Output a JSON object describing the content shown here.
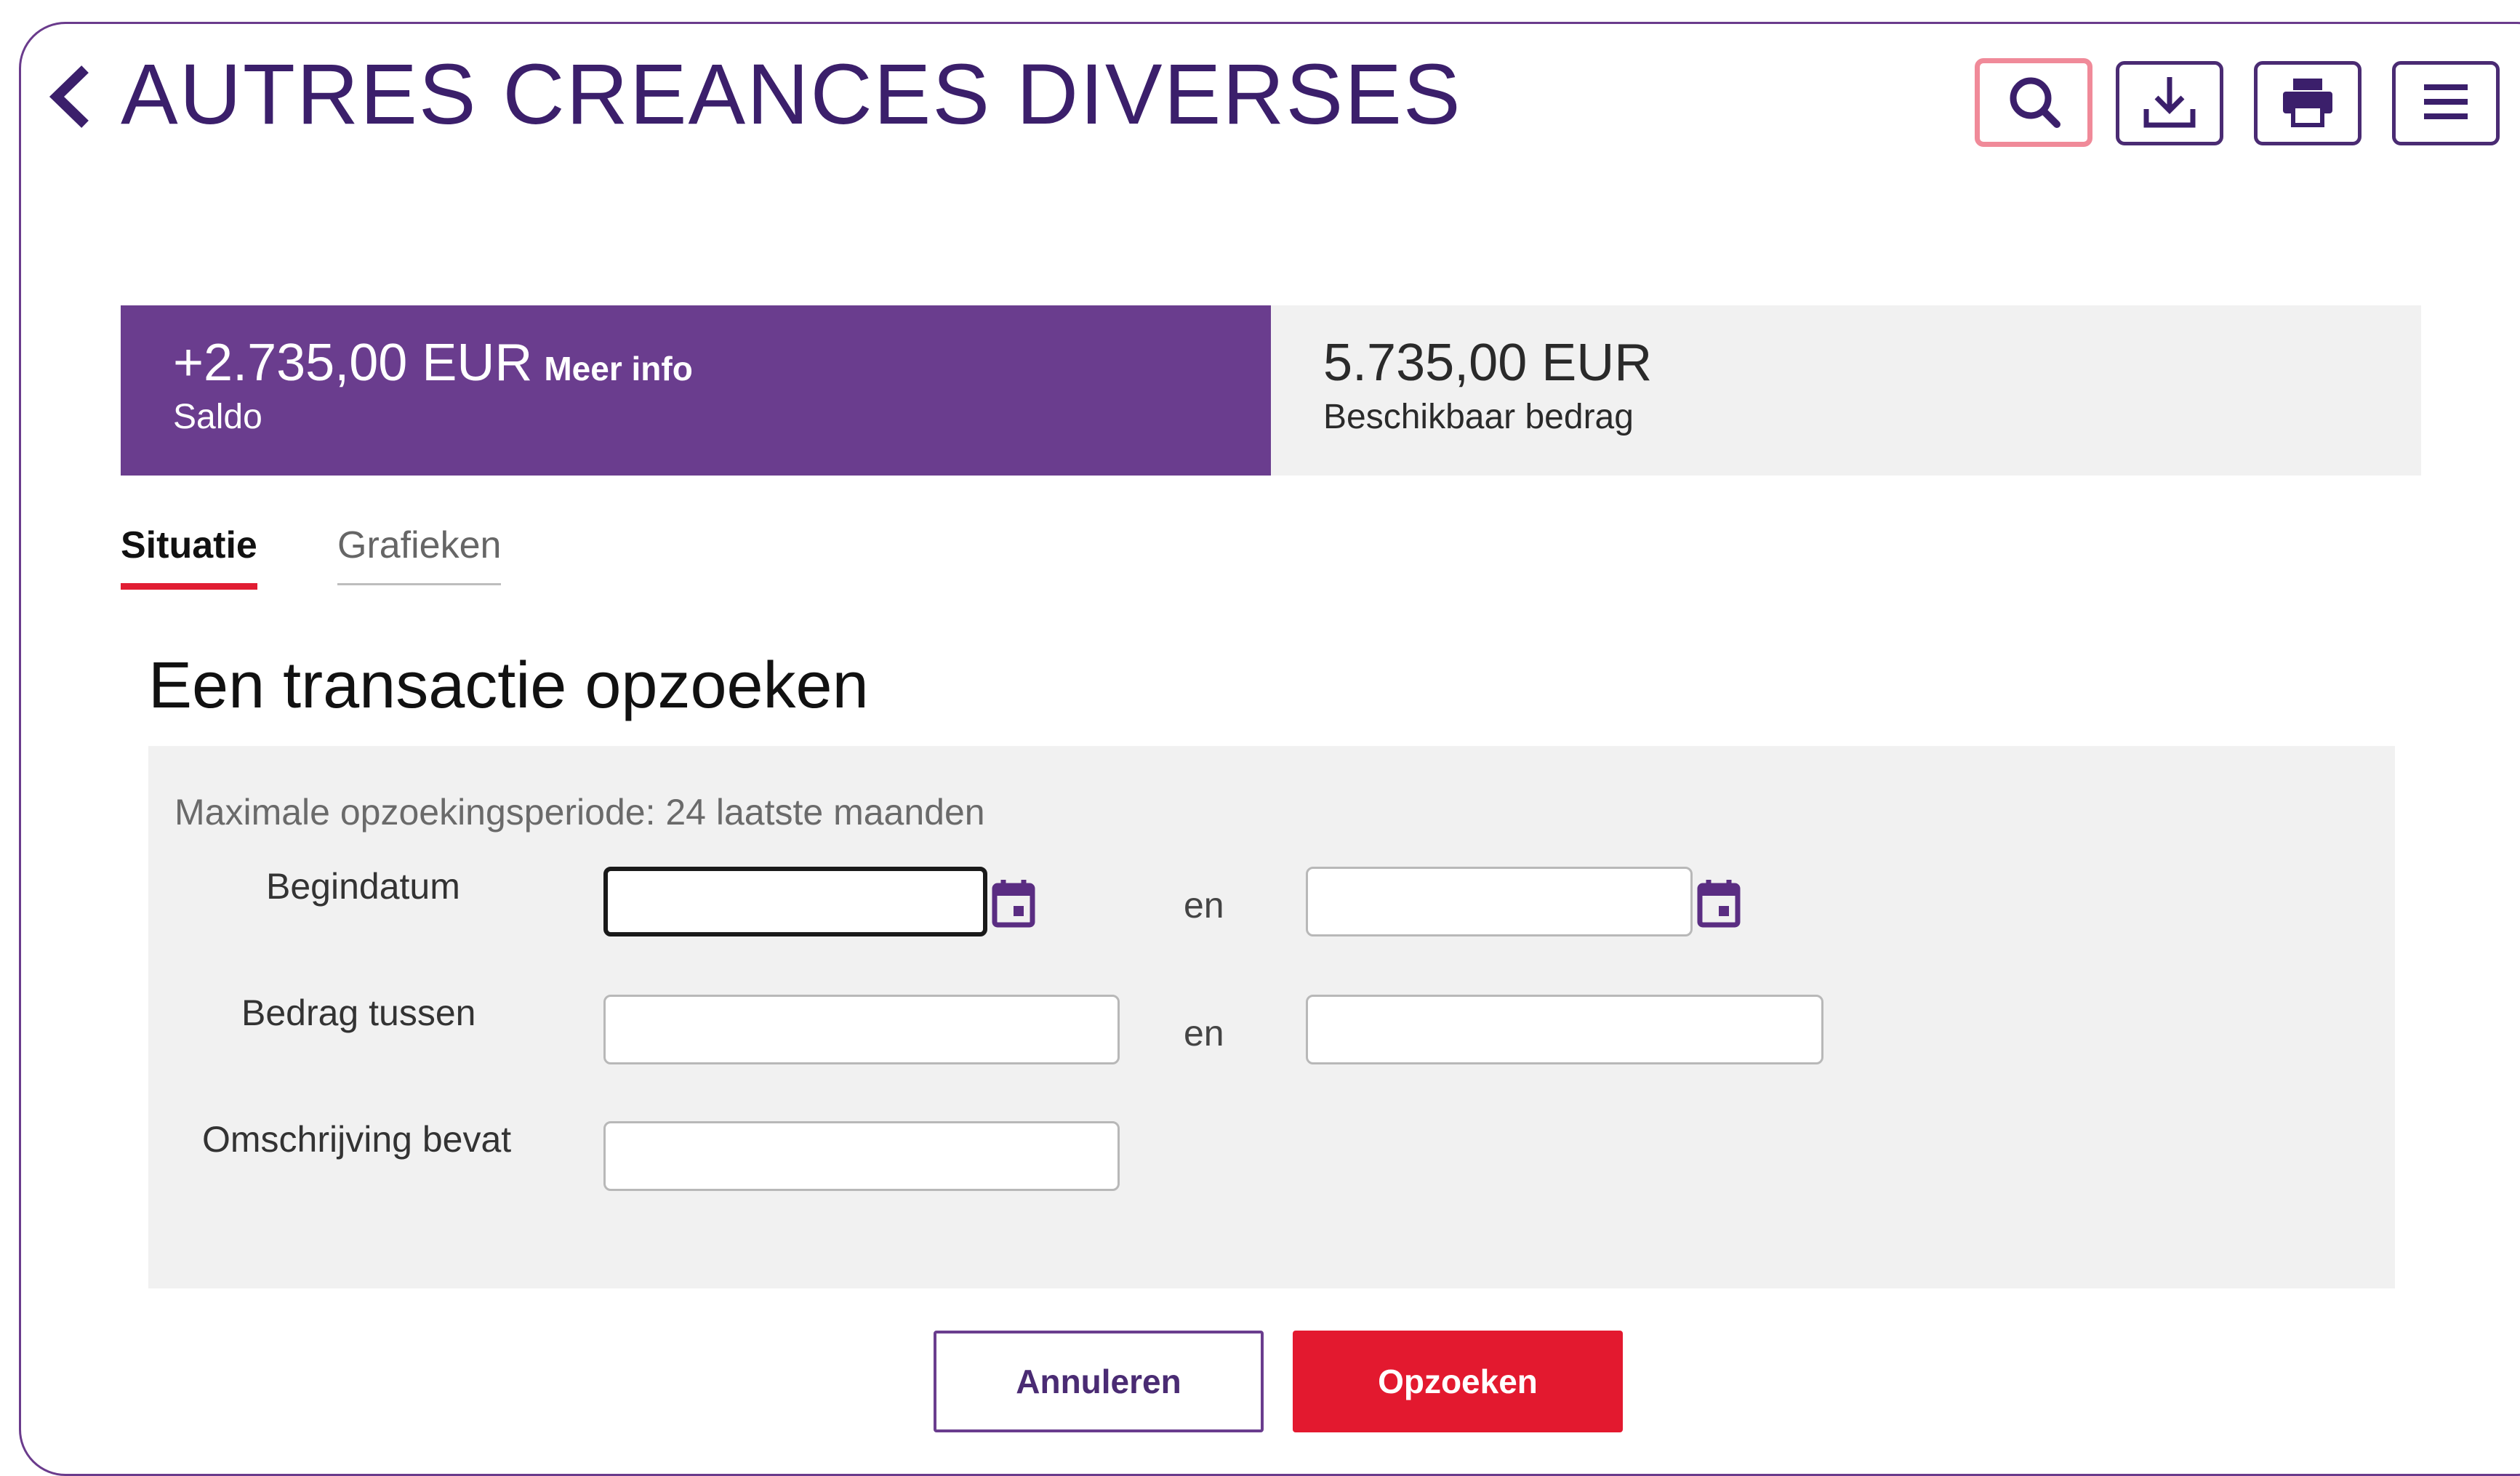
{
  "header": {
    "title": "AUTRES CREANCES DIVERSES",
    "tools": [
      {
        "name": "search-icon"
      },
      {
        "name": "download-icon"
      },
      {
        "name": "printer-icon"
      },
      {
        "name": "menu-icon"
      }
    ]
  },
  "balance": {
    "saldo_amount": "+2.735,00 EUR",
    "meer_info": "Meer info",
    "saldo_label": "Saldo",
    "available_amount": "5.735,00 EUR",
    "available_label": "Beschikbaar bedrag"
  },
  "tabs": [
    {
      "label": "Situatie",
      "active": true
    },
    {
      "label": "Grafieken",
      "active": false
    }
  ],
  "search": {
    "title": "Een transactie opzoeken",
    "note": "Maximale opzoekingsperiode: 24 laatste maanden",
    "begindatum_label": "Begindatum",
    "bedrag_label": "Bedrag tussen",
    "omschrijving_label": "Omschrijving bevat",
    "en_label": "en",
    "values": {
      "date_from": "",
      "date_to": "",
      "amount_from": "",
      "amount_to": "",
      "description": ""
    }
  },
  "actions": {
    "cancel_label": "Annuleren",
    "search_label": "Opzoeken"
  },
  "colors": {
    "brand_purple": "#6a3d8e",
    "title_purple": "#3b1f6b",
    "accent_red": "#e3192f",
    "panel_grey": "#f1f1f1"
  }
}
